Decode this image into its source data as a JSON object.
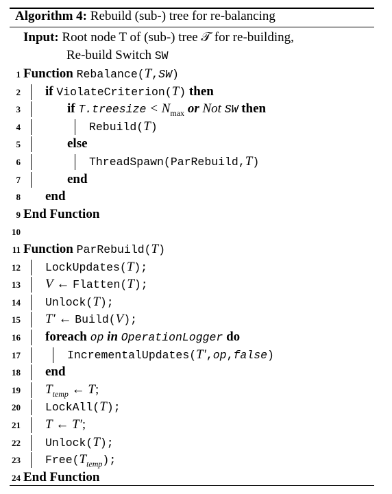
{
  "caption": {
    "label": "Algorithm 4:",
    "text": "Rebuild (sub-) tree for re-balancing"
  },
  "input": {
    "label": "Input:",
    "line1": "Root node T of (sub-) tree 𝒯 for re-building,",
    "line2_text": "Re-build Switch ",
    "line2_tt": "SW"
  },
  "lines": [
    {
      "n": "1",
      "indent": 0,
      "bars": 0,
      "parts": [
        {
          "t": "Function ",
          "s": "b"
        },
        {
          "t": "Rebalance(",
          "s": "tt"
        },
        {
          "t": "T",
          "s": "i"
        },
        {
          "t": ",",
          "s": "tt"
        },
        {
          "t": "SW",
          "s": "tti"
        },
        {
          "t": ")",
          "s": "tt"
        }
      ]
    },
    {
      "n": "2",
      "indent": 1,
      "bars": 1,
      "parts": [
        {
          "t": "if ",
          "s": "b"
        },
        {
          "t": "ViolateCriterion(",
          "s": "tt"
        },
        {
          "t": "T",
          "s": "i"
        },
        {
          "t": ")",
          "s": "tt"
        },
        {
          "t": " then",
          "s": "b"
        }
      ]
    },
    {
      "n": "3",
      "indent": 2,
      "bars": 1,
      "parts": [
        {
          "t": "if ",
          "s": "b"
        },
        {
          "t": "T.treesize",
          "s": "tti"
        },
        {
          "t": " < N",
          "s": "i"
        },
        {
          "t": "max",
          "s": "sub"
        },
        {
          "t": " or",
          "s": "bi"
        },
        {
          "t": " Not ",
          "s": "i"
        },
        {
          "t": "SW",
          "s": "tti"
        },
        {
          "t": " then",
          "s": "b"
        }
      ]
    },
    {
      "n": "4",
      "indent": 3,
      "bars": 3,
      "parts": [
        {
          "t": "Rebuild(",
          "s": "tt"
        },
        {
          "t": "T",
          "s": "i"
        },
        {
          "t": ")",
          "s": "tt"
        }
      ]
    },
    {
      "n": "5",
      "indent": 2,
      "bars": 1,
      "parts": [
        {
          "t": "else",
          "s": "b"
        }
      ]
    },
    {
      "n": "6",
      "indent": 3,
      "bars": 3,
      "parts": [
        {
          "t": "ThreadSpawn(ParRebuild,",
          "s": "tt"
        },
        {
          "t": "T",
          "s": "i"
        },
        {
          "t": ")",
          "s": "tt"
        }
      ]
    },
    {
      "n": "7",
      "indent": 2,
      "bars": 1,
      "parts": [
        {
          "t": "end",
          "s": "b"
        }
      ]
    },
    {
      "n": "8",
      "indent": 1,
      "bars": 0,
      "parts": [
        {
          "t": "end",
          "s": "b"
        }
      ]
    },
    {
      "n": "9",
      "indent": 0,
      "bars": 0,
      "parts": [
        {
          "t": "End Function",
          "s": "b"
        }
      ]
    },
    {
      "n": "10",
      "indent": 0,
      "bars": 0,
      "parts": []
    },
    {
      "n": "11",
      "indent": 0,
      "bars": 0,
      "parts": [
        {
          "t": "Function ",
          "s": "b"
        },
        {
          "t": "ParRebuild(",
          "s": "tt"
        },
        {
          "t": "T",
          "s": "i"
        },
        {
          "t": ")",
          "s": "tt"
        }
      ]
    },
    {
      "n": "12",
      "indent": 1,
      "bars": 1,
      "parts": [
        {
          "t": "LockUpdates(",
          "s": "tt"
        },
        {
          "t": "T",
          "s": "i"
        },
        {
          "t": ");",
          "s": "tt"
        }
      ]
    },
    {
      "n": "13",
      "indent": 1,
      "bars": 1,
      "parts": [
        {
          "t": "V",
          "s": "i"
        },
        {
          "t": " ← ",
          "s": "n"
        },
        {
          "t": "Flatten(",
          "s": "tt"
        },
        {
          "t": "T",
          "s": "i"
        },
        {
          "t": ");",
          "s": "tt"
        }
      ]
    },
    {
      "n": "14",
      "indent": 1,
      "bars": 1,
      "parts": [
        {
          "t": "Unlock(",
          "s": "tt"
        },
        {
          "t": "T",
          "s": "i"
        },
        {
          "t": ");",
          "s": "tt"
        }
      ]
    },
    {
      "n": "15",
      "indent": 1,
      "bars": 1,
      "parts": [
        {
          "t": "T′",
          "s": "i"
        },
        {
          "t": " ← ",
          "s": "n"
        },
        {
          "t": "Build(",
          "s": "tt"
        },
        {
          "t": "V",
          "s": "i"
        },
        {
          "t": ");",
          "s": "tt"
        }
      ]
    },
    {
      "n": "16",
      "indent": 1,
      "bars": 1,
      "parts": [
        {
          "t": "foreach ",
          "s": "b"
        },
        {
          "t": "op",
          "s": "tti"
        },
        {
          "t": " in ",
          "s": "bi"
        },
        {
          "t": "OperationLogger",
          "s": "tti"
        },
        {
          "t": " do",
          "s": "b"
        }
      ]
    },
    {
      "n": "17",
      "indent": 2,
      "bars": 2,
      "parts": [
        {
          "t": "IncrementalUpdates(",
          "s": "tt"
        },
        {
          "t": "T′",
          "s": "i"
        },
        {
          "t": ",",
          "s": "tt"
        },
        {
          "t": "op",
          "s": "tti"
        },
        {
          "t": ",",
          "s": "tt"
        },
        {
          "t": "false",
          "s": "tti"
        },
        {
          "t": ")",
          "s": "tt"
        }
      ]
    },
    {
      "n": "18",
      "indent": 1,
      "bars": 1,
      "parts": [
        {
          "t": "end",
          "s": "b"
        }
      ]
    },
    {
      "n": "19",
      "indent": 1,
      "bars": 1,
      "parts": [
        {
          "t": "T",
          "s": "i"
        },
        {
          "t": "temp",
          "s": "subi"
        },
        {
          "t": " ← ",
          "s": "n"
        },
        {
          "t": "T",
          "s": "i"
        },
        {
          "t": ";",
          "s": "n"
        }
      ]
    },
    {
      "n": "20",
      "indent": 1,
      "bars": 1,
      "parts": [
        {
          "t": "LockAll(",
          "s": "tt"
        },
        {
          "t": "T",
          "s": "i"
        },
        {
          "t": ");",
          "s": "tt"
        }
      ]
    },
    {
      "n": "21",
      "indent": 1,
      "bars": 1,
      "parts": [
        {
          "t": "T",
          "s": "i"
        },
        {
          "t": " ← ",
          "s": "n"
        },
        {
          "t": "T′",
          "s": "i"
        },
        {
          "t": ";",
          "s": "n"
        }
      ]
    },
    {
      "n": "22",
      "indent": 1,
      "bars": 1,
      "parts": [
        {
          "t": "Unlock(",
          "s": "tt"
        },
        {
          "t": "T",
          "s": "i"
        },
        {
          "t": ");",
          "s": "tt"
        }
      ]
    },
    {
      "n": "23",
      "indent": 1,
      "bars": 1,
      "parts": [
        {
          "t": "Free(",
          "s": "tt"
        },
        {
          "t": "T",
          "s": "i"
        },
        {
          "t": "temp",
          "s": "subi"
        },
        {
          "t": ");",
          "s": "tt"
        }
      ]
    },
    {
      "n": "24",
      "indent": 0,
      "bars": 0,
      "parts": [
        {
          "t": "End Function",
          "s": "b"
        }
      ]
    }
  ]
}
